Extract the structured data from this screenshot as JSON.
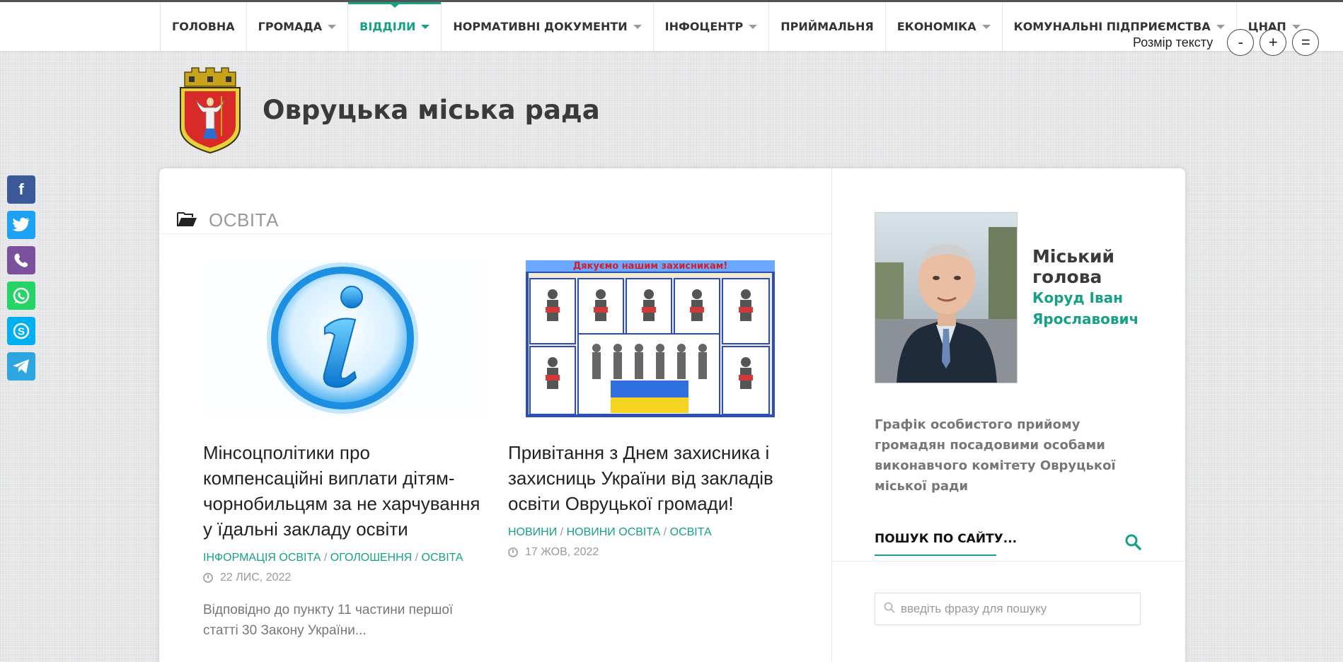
{
  "nav": {
    "items": [
      {
        "label": "ГОЛОВНА",
        "dropdown": false,
        "active": false
      },
      {
        "label": "ГРОМАДА",
        "dropdown": true,
        "active": false
      },
      {
        "label": "ВІДДІЛИ",
        "dropdown": true,
        "active": true
      },
      {
        "label": "НОРМАТИВНІ ДОКУМЕНТИ",
        "dropdown": true,
        "active": false
      },
      {
        "label": "ІНФОЦЕНТР",
        "dropdown": true,
        "active": false
      },
      {
        "label": "ПРИЙМАЛЬНЯ",
        "dropdown": false,
        "active": false
      },
      {
        "label": "ЕКОНОМІКА",
        "dropdown": true,
        "active": false
      },
      {
        "label": "КОМУНАЛЬНІ ПІДПРИЄМСТВА",
        "dropdown": true,
        "active": false
      },
      {
        "label": "ЦНАП",
        "dropdown": true,
        "active": false
      }
    ],
    "accent_color": "#16a085"
  },
  "text_size": {
    "label": "Розмір тексту",
    "decrease": "-",
    "increase": "+",
    "reset": "="
  },
  "header": {
    "site_title": "Овруцька міська рада"
  },
  "social": {
    "items": [
      {
        "name": "facebook",
        "glyph": "f",
        "color": "#3b5998"
      },
      {
        "name": "twitter",
        "glyph": "t",
        "color": "#1da1f2"
      },
      {
        "name": "viber",
        "glyph": "v",
        "color": "#7b519d"
      },
      {
        "name": "whatsapp",
        "glyph": "w",
        "color": "#25d366"
      },
      {
        "name": "skype",
        "glyph": "S",
        "color": "#00aff0"
      },
      {
        "name": "telegram",
        "glyph": "➤",
        "color": "#2ca5e0"
      }
    ]
  },
  "category": {
    "title": "ОСВІТА"
  },
  "posts": [
    {
      "title": "Мінсоцполітики про компенсаційні виплати дітям-чорнобильцям за не харчування у їдальні закладу освіти",
      "categories": [
        "ІНФОРМАЦІЯ ОСВІТА",
        "ОГОЛОШЕННЯ",
        "ОСВІТА"
      ],
      "date": "22 ЛИС, 2022",
      "excerpt": "Відповідно до пункту 11 частини першої статті 30 Закону України..."
    },
    {
      "title": "Привітання з Днем захисника і захисниць України від закладів освіти Овруцької громади!",
      "categories": [
        "НОВИНИ",
        "НОВИНИ ОСВІТА",
        "ОСВІТА"
      ],
      "date": "17 ЖОВ, 2022",
      "image_banner": "Дякуємо нашим захисникам!"
    }
  ],
  "sidebar": {
    "mayor_role": "Міський голова",
    "mayor_name": "Коруд Іван Ярославович",
    "schedule_link": "Графік особистого прийому громадян посадовими особами виконавчого комітету Овруцької міської ради",
    "search_label": "ПОШУК ПО САЙТУ...",
    "search_placeholder": "введіть фразу для пошуку"
  }
}
